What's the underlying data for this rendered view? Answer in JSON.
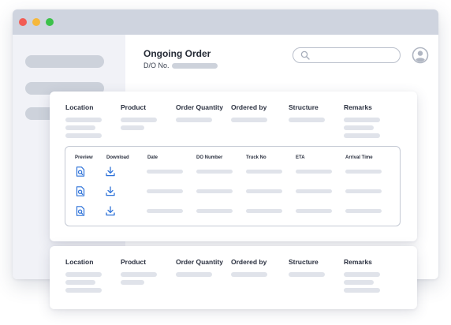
{
  "window": {
    "controls": [
      "close",
      "minimize",
      "maximize"
    ],
    "control_colors": {
      "close": "#f25c54",
      "minimize": "#f6b83b",
      "maximize": "#3cc14a"
    }
  },
  "header": {
    "title": "Ongoing Order",
    "do_label": "D/O No.",
    "search_placeholder": "",
    "icons": {
      "search": "search-icon",
      "user": "user-avatar-icon"
    }
  },
  "colors": {
    "accent": "#2f73d9",
    "placeholder_bar": "#e0e3ea",
    "sidebar": "#f1f2f7"
  },
  "order_columns": [
    "Location",
    "Product",
    "Order Quantity",
    "Ordered by",
    "Structure",
    "Remarks"
  ],
  "shipments": {
    "columns": [
      "Preview",
      "Download",
      "Date",
      "DO Number",
      "Truck No",
      "ETA",
      "Arrival Time"
    ],
    "row_icons": {
      "preview": "document-search-icon",
      "download": "download-icon"
    }
  }
}
